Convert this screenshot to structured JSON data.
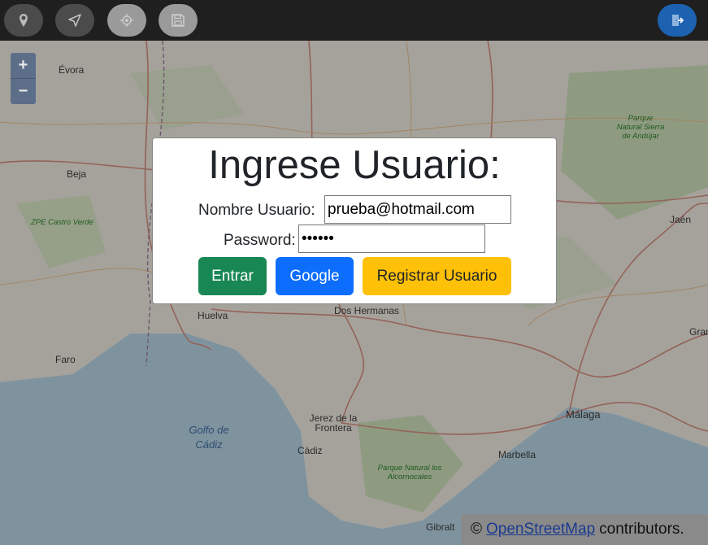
{
  "toolbar": {
    "buttons": [
      {
        "name": "location",
        "icon": "map-pin-icon"
      },
      {
        "name": "navigate",
        "icon": "navigation-arrow-icon"
      },
      {
        "name": "target",
        "icon": "crosshair-icon"
      },
      {
        "name": "save",
        "icon": "floppy-disk-icon"
      },
      {
        "name": "logout",
        "icon": "exit-door-icon"
      }
    ]
  },
  "zoom": {
    "in": "+",
    "out": "−"
  },
  "map": {
    "places": [
      "Évora",
      "Beja",
      "ZPE Castro Verde",
      "Huelva",
      "Faro",
      "Dos Hermanas",
      "Parque Natural Sierra de Andújar",
      "Jaén",
      "Gran",
      "Golfo de Cádiz",
      "Jerez de la Frontera",
      "Cádiz",
      "Parque Natural los Alcornocales",
      "Marbella",
      "Málaga",
      "Gibralt"
    ]
  },
  "attribution": {
    "prefix": "©",
    "link": "OpenStreetMap",
    "suffix": "contributors."
  },
  "login": {
    "title": "Ingrese Usuario:",
    "username_label": "Nombre Usuario:",
    "username_value": "prueba@hotmail.com",
    "password_label": "Password:",
    "password_value": "••••••",
    "buttons": {
      "enter": "Entrar",
      "google": "Google",
      "register": "Registrar Usuario"
    }
  },
  "colors": {
    "enter": "#198754",
    "google": "#0d6efd",
    "register": "#ffc107",
    "toolbar": "#1f1f1f"
  }
}
